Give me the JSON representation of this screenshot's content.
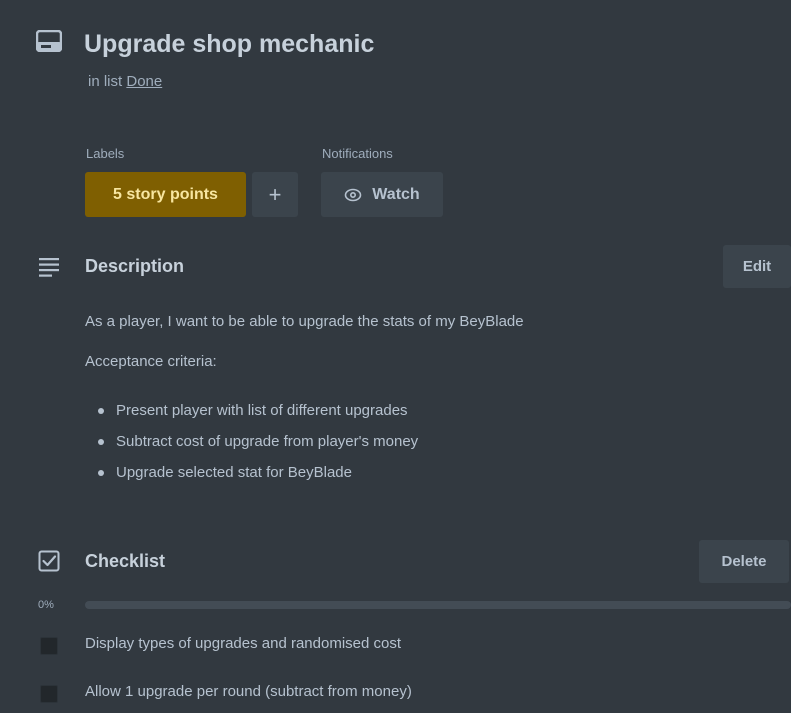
{
  "card": {
    "title": "Upgrade shop mechanic",
    "in_list_prefix": "in list",
    "list_name": "Done"
  },
  "labels": {
    "heading": "Labels",
    "items": [
      {
        "text": "5 story points",
        "color": "#7f5f01"
      }
    ],
    "add_symbol": "+"
  },
  "notifications": {
    "heading": "Notifications",
    "watch_label": "Watch"
  },
  "description": {
    "title": "Description",
    "edit_label": "Edit",
    "paragraphs": [
      "As a player, I want to be able to upgrade the stats of my BeyBlade",
      "Acceptance criteria:"
    ],
    "bullets": [
      "Present player with list of different upgrades",
      "Subtract cost of upgrade from player's money",
      "Upgrade selected stat for BeyBlade"
    ]
  },
  "checklist": {
    "title": "Checklist",
    "delete_label": "Delete",
    "progress_text": "0%",
    "progress_percent": 0,
    "items": [
      {
        "text": "Display types of upgrades and randomised cost",
        "checked": false
      },
      {
        "text": "Allow 1 upgrade per round (subtract from money)",
        "checked": false
      }
    ]
  },
  "icons": {
    "card": "card-icon",
    "description": "description-lines-icon",
    "checklist": "checklist-icon",
    "watch": "eye-icon"
  }
}
